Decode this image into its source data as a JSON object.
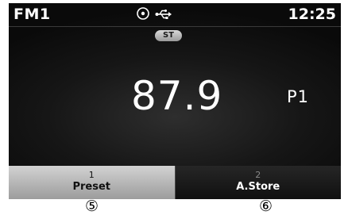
{
  "status_bar": {
    "band": "FM1",
    "time": "12:25",
    "icons": [
      "disc-icon",
      "usb-icon"
    ]
  },
  "stereo_badge": "ST",
  "tuner": {
    "frequency": "87.9",
    "preset": "P1"
  },
  "softkeys": [
    {
      "number": "1",
      "label": "Preset",
      "state": "selected"
    },
    {
      "number": "2",
      "label": "A.Store",
      "state": "normal"
    }
  ],
  "callouts": [
    "⑤",
    "⑥"
  ],
  "colors": {
    "screen_bg": "#111111",
    "text": "#ffffff",
    "selected_key": "#bdbdbd",
    "badge": "#c4c4c4"
  }
}
